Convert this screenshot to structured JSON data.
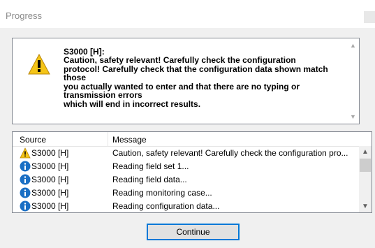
{
  "window": {
    "title": "Progress"
  },
  "message_box": {
    "title": "S3000 [H]:",
    "text": "Caution, safety relevant! Carefully check the configuration\nprotocol! Carefully check that the configuration data shown match\nthose\nyou actually wanted to enter and that there are no typing or\ntransmission errors\nwhich will end in incorrect results.",
    "icon": "warning-icon"
  },
  "log": {
    "columns": [
      "Source",
      "Message"
    ],
    "rows": [
      {
        "icon": "warning-icon",
        "source": "S3000 [H]",
        "message": "Caution, safety relevant! Carefully check the configuration pro..."
      },
      {
        "icon": "info-icon",
        "source": "S3000 [H]",
        "message": "Reading field set 1..."
      },
      {
        "icon": "info-icon",
        "source": "S3000 [H]",
        "message": "Reading field data..."
      },
      {
        "icon": "info-icon",
        "source": "S3000 [H]",
        "message": "Reading monitoring case..."
      },
      {
        "icon": "info-icon",
        "source": "S3000 [H]",
        "message": "Reading configuration data..."
      }
    ]
  },
  "buttons": {
    "continue_label": "Continue"
  },
  "colors": {
    "accent": "#0078d7",
    "info": "#1a6fc4",
    "warning": "#f5c518"
  }
}
